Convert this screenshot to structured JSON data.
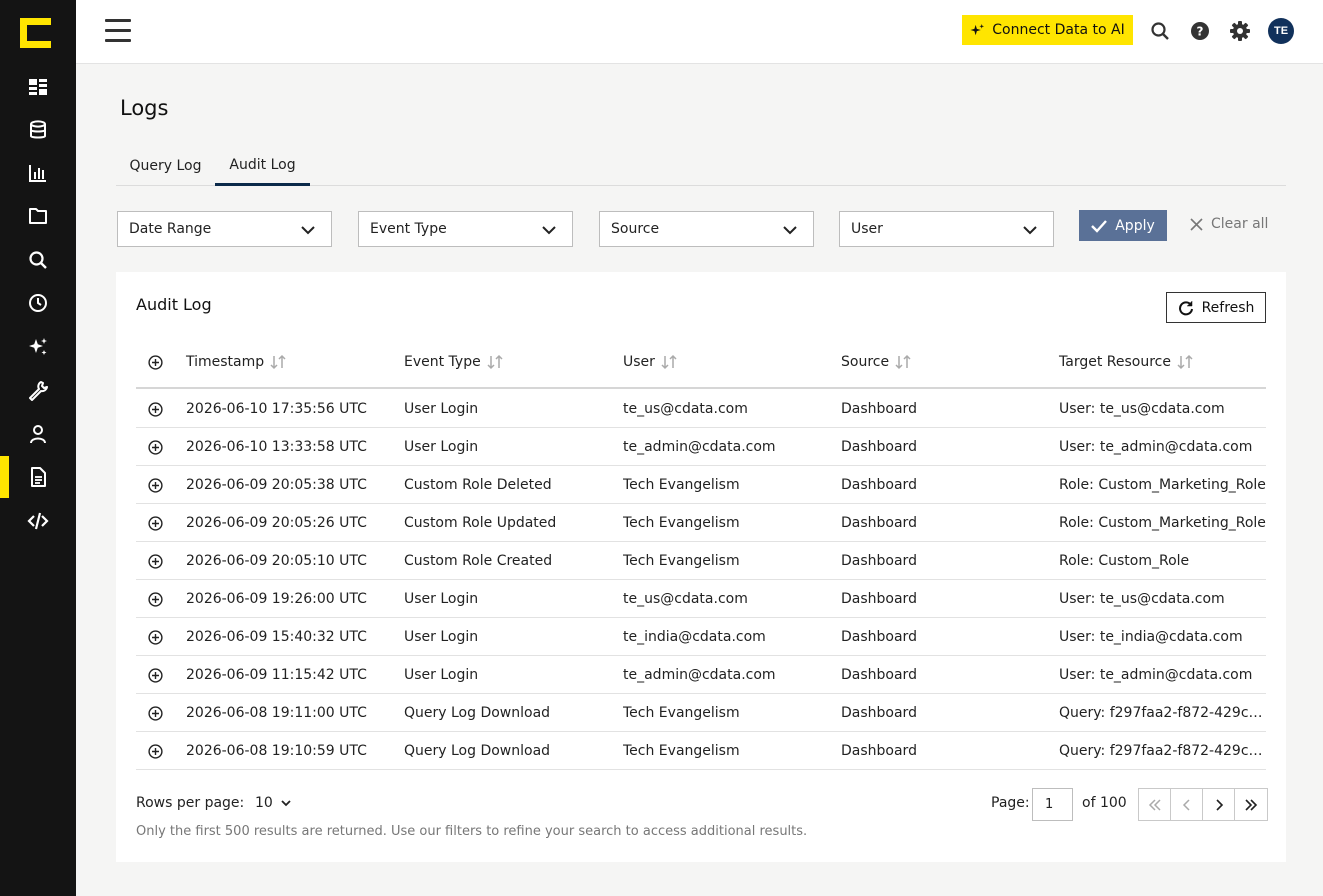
{
  "header": {
    "connect_label": "Connect Data to AI",
    "avatar_initials": "TE"
  },
  "colors": {
    "accent": "#ffe500",
    "sidebar_bg": "#141414",
    "apply_bg": "#5a7197",
    "avatar_bg": "#11315b"
  },
  "sidebar": {
    "items": [
      {
        "icon": "dashboard-icon"
      },
      {
        "icon": "database-icon"
      },
      {
        "icon": "bar-chart-icon"
      },
      {
        "icon": "folder-icon"
      },
      {
        "icon": "search-icon"
      },
      {
        "icon": "clock-icon"
      },
      {
        "icon": "sparkle-icon"
      },
      {
        "icon": "wrench-icon"
      },
      {
        "icon": "user-icon"
      },
      {
        "icon": "document-icon",
        "active": true
      },
      {
        "icon": "code-icon"
      }
    ]
  },
  "page": {
    "title": "Logs",
    "tabs": [
      "Query Log",
      "Audit Log"
    ],
    "active_tab": "Audit Log"
  },
  "filters": {
    "date_range": "Date Range",
    "event_type": "Event Type",
    "source": "Source",
    "user": "User",
    "apply_label": "Apply",
    "clear_label": "Clear all"
  },
  "table": {
    "title": "Audit Log",
    "refresh_label": "Refresh",
    "columns": [
      "Timestamp",
      "Event Type",
      "User",
      "Source",
      "Target Resource"
    ],
    "rows": [
      [
        "2026-06-10 17:35:56 UTC",
        "User Login",
        "te_us@cdata.com",
        "Dashboard",
        "User: te_us@cdata.com"
      ],
      [
        "2026-06-10 13:33:58 UTC",
        "User Login",
        "te_admin@cdata.com",
        "Dashboard",
        "User: te_admin@cdata.com"
      ],
      [
        "2026-06-09 20:05:38 UTC",
        "Custom Role Deleted",
        "Tech Evangelism",
        "Dashboard",
        "Role: Custom_Marketing_Role"
      ],
      [
        "2026-06-09 20:05:26 UTC",
        "Custom Role Updated",
        "Tech Evangelism",
        "Dashboard",
        "Role: Custom_Marketing_Role"
      ],
      [
        "2026-06-09 20:05:10 UTC",
        "Custom Role Created",
        "Tech Evangelism",
        "Dashboard",
        "Role: Custom_Role"
      ],
      [
        "2026-06-09 19:26:00 UTC",
        "User Login",
        "te_us@cdata.com",
        "Dashboard",
        "User: te_us@cdata.com"
      ],
      [
        "2026-06-09 15:40:32 UTC",
        "User Login",
        "te_india@cdata.com",
        "Dashboard",
        "User: te_india@cdata.com"
      ],
      [
        "2026-06-09 11:15:42 UTC",
        "User Login",
        "te_admin@cdata.com",
        "Dashboard",
        "User: te_admin@cdata.com"
      ],
      [
        "2026-06-08 19:11:00 UTC",
        "Query Log Download",
        "Tech Evangelism",
        "Dashboard",
        "Query: f297faa2-f872-429c-9…"
      ],
      [
        "2026-06-08 19:10:59 UTC",
        "Query Log Download",
        "Tech Evangelism",
        "Dashboard",
        "Query: f297faa2-f872-429c-9…"
      ]
    ]
  },
  "pagination": {
    "rows_per_page_label": "Rows per page:",
    "rows_per_page": "10",
    "page_label": "Page:",
    "current_page": "1",
    "of_label": "of 100",
    "note": "Only the first 500 results are returned. Use our filters to refine your search to access additional results."
  }
}
